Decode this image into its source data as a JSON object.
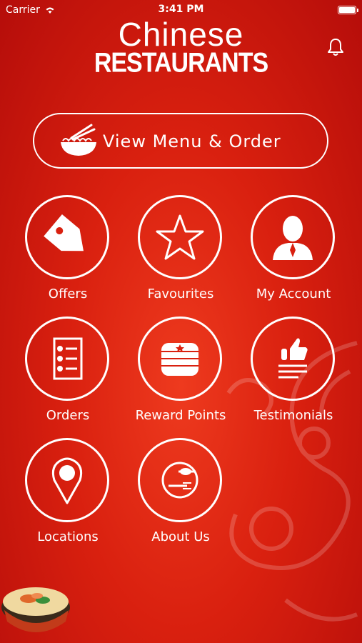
{
  "status_bar": {
    "carrier": "Carrier",
    "time": "3:41 PM"
  },
  "logo": {
    "line1": "Chinese",
    "line2": "RESTAURANTS"
  },
  "menu_button": {
    "label": "View Menu & Order"
  },
  "tiles": [
    {
      "label": "Offers",
      "icon": "tag-icon"
    },
    {
      "label": "Favourites",
      "icon": "star-icon"
    },
    {
      "label": "My Account",
      "icon": "person-icon"
    },
    {
      "label": "Orders",
      "icon": "list-icon"
    },
    {
      "label": "Reward Points",
      "icon": "coin-stack-icon"
    },
    {
      "label": "Testimonials",
      "icon": "thumbs-up-icon"
    },
    {
      "label": "Locations",
      "icon": "map-pin-icon"
    },
    {
      "label": "About Us",
      "icon": "plate-cutlery-icon"
    }
  ],
  "colors": {
    "background": "#d9200f",
    "foreground": "#ffffff"
  }
}
